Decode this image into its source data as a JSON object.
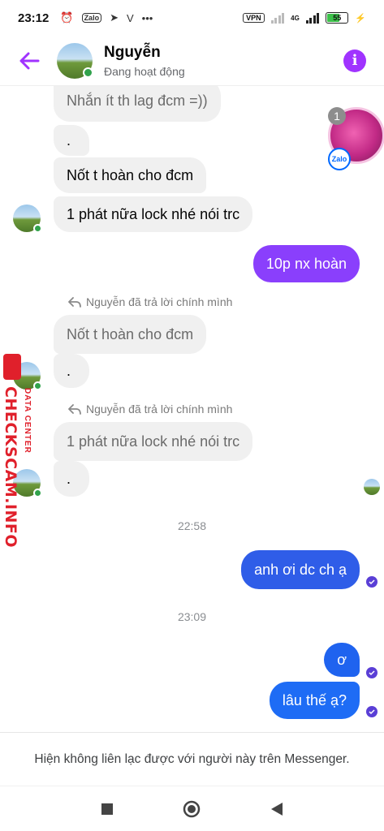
{
  "status_bar": {
    "time": "23:12",
    "zalo_label": "Zalo",
    "vpn": "VPN",
    "network": "4G",
    "battery": "55"
  },
  "header": {
    "name": "Nguyễn",
    "status": "Đang hoạt động"
  },
  "chat_head": {
    "count": "1",
    "badge": "Zalo"
  },
  "messages": {
    "m1": "Nhắn ít th lag đcm =))",
    "m2": ".",
    "m3": "Nốt t hoàn cho đcm",
    "m4": "1 phát nữa lock nhé nói trc",
    "m5": "10p nx hoàn",
    "reply1": "Nguyễn đã trả lời chính mình",
    "m6": "Nốt t hoàn cho đcm",
    "m7": ".",
    "reply2": "Nguyễn đã trả lời chính mình",
    "m8": "1 phát nữa lock nhé nói trc",
    "m9": ".",
    "ts1": "22:58",
    "m10": "anh ơi dc ch ạ",
    "ts2": "23:09",
    "m11": "ơ",
    "m12": "lâu thế ạ?"
  },
  "watermark": {
    "main": "CHECKSCAM.INFO",
    "sub": "DATA CENTER"
  },
  "footer": {
    "text": "Hiện không liên lạc được với người này trên Messenger."
  },
  "colors": {
    "accent_purple": "#a033ff",
    "bubble_purple": "#8a3ffc",
    "bubble_blue": "#1e6cf5",
    "online": "#31a24c",
    "watermark": "#e0202b"
  }
}
